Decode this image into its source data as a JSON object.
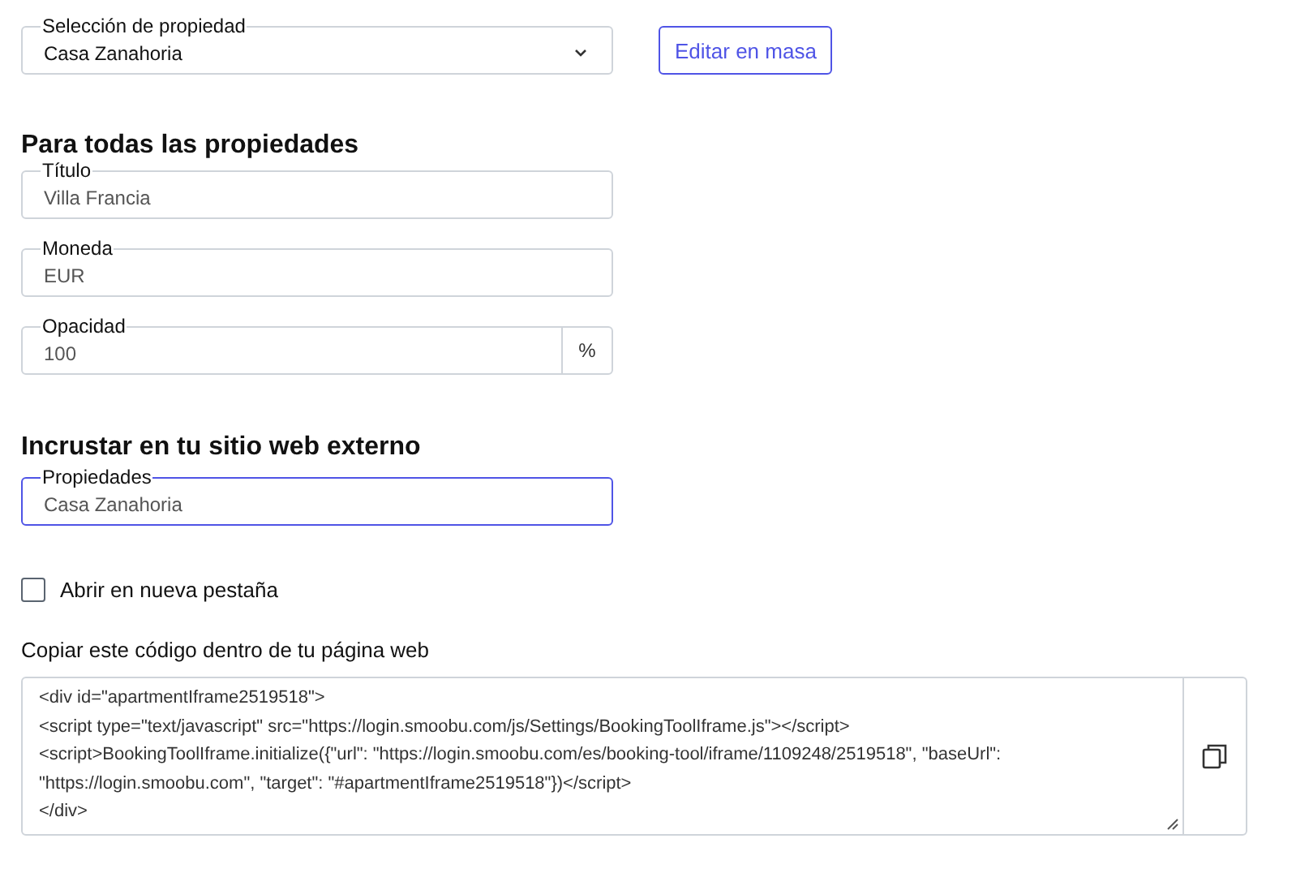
{
  "property_selection": {
    "label": "Selección de propiedad",
    "value": "Casa Zanahoria",
    "kind": "select",
    "focused": false
  },
  "bulk_edit_button": "Editar en masa",
  "all_properties": {
    "heading": "Para todas las propiedades",
    "fields": [
      {
        "label": "Título",
        "value": "Villa Francia",
        "kind": "text",
        "focused": false
      },
      {
        "label": "Moneda",
        "value": "EUR",
        "kind": "text",
        "focused": false
      },
      {
        "label": "Opacidad",
        "value": "100",
        "kind": "suffix",
        "suffix": "%",
        "focused": false
      }
    ]
  },
  "embed": {
    "heading": "Incrustar en tu sitio web externo",
    "properties_field": {
      "label": "Propiedades",
      "value": "Casa Zanahoria",
      "kind": "text",
      "focused": true
    },
    "open_new_tab": {
      "label": "Abrir en nueva pestaña",
      "checked": false
    },
    "code_label": "Copiar este código dentro de tu página web",
    "code_lines": [
      "<div id=\"apartmentIframe2519518\">",
      "<script type=\"text/javascript\" src=\"https://login.smoobu.com/js/Settings/BookingToolIframe.js\"></script>",
      "<script>BookingToolIframe.initialize({\"url\": \"https://login.smoobu.com/es/booking-tool/iframe/1109248/2519518\", \"baseUrl\": \"https://login.smoobu.com\", \"target\": \"#apartmentIframe2519518\"})</script>",
      "</div>"
    ]
  }
}
